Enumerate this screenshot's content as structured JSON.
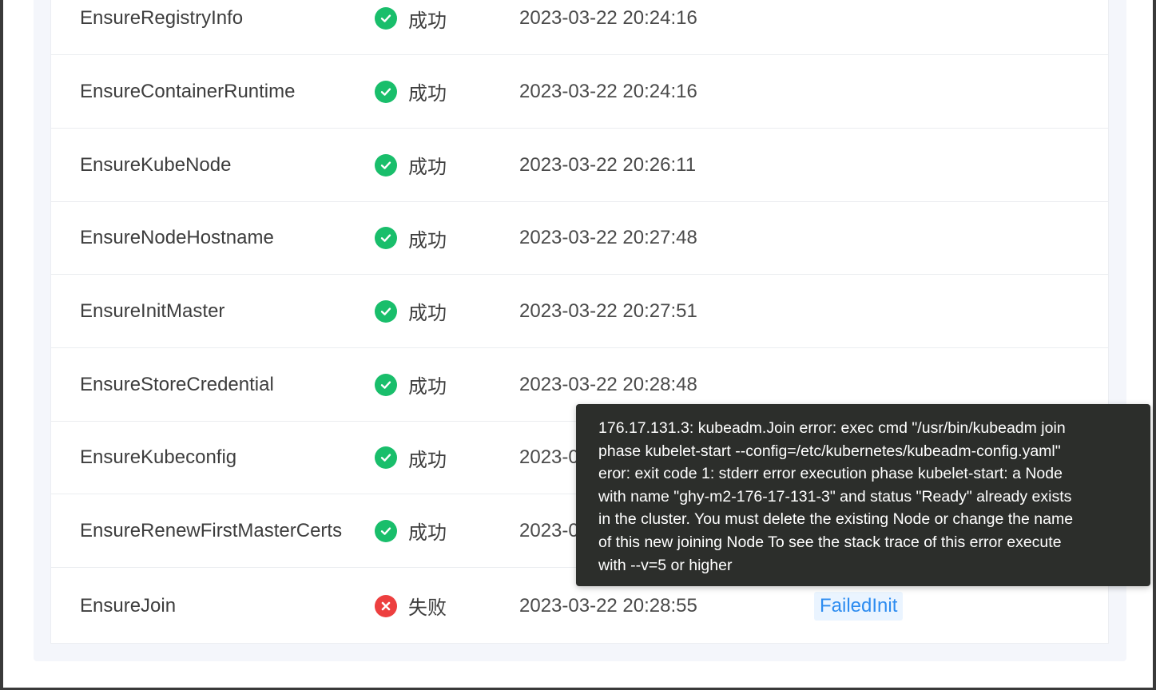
{
  "colors": {
    "success": "#19be6b",
    "failure": "#ed3f3f",
    "reason_text": "#2d8cf0",
    "reason_bg": "#eaf4ff",
    "tooltip_bg": "#2c2e2b"
  },
  "rows": [
    {
      "name": "EnsureRegistryInfo",
      "status": "成功",
      "status_icon": "success-check-icon",
      "time": "2023-03-22 20:24:16",
      "reason": ""
    },
    {
      "name": "EnsureContainerRuntime",
      "status": "成功",
      "status_icon": "success-check-icon",
      "time": "2023-03-22 20:24:16",
      "reason": ""
    },
    {
      "name": "EnsureKubeNode",
      "status": "成功",
      "status_icon": "success-check-icon",
      "time": "2023-03-22 20:26:11",
      "reason": ""
    },
    {
      "name": "EnsureNodeHostname",
      "status": "成功",
      "status_icon": "success-check-icon",
      "time": "2023-03-22 20:27:48",
      "reason": ""
    },
    {
      "name": "EnsureInitMaster",
      "status": "成功",
      "status_icon": "success-check-icon",
      "time": "2023-03-22 20:27:51",
      "reason": ""
    },
    {
      "name": "EnsureStoreCredential",
      "status": "成功",
      "status_icon": "success-check-icon",
      "time": "2023-03-22 20:28:48",
      "reason": ""
    },
    {
      "name": "EnsureKubeconfig",
      "status": "成功",
      "status_icon": "success-check-icon",
      "time": "2023-03-22 20:28:48",
      "reason": ""
    },
    {
      "name": "EnsureRenewFirstMasterCerts",
      "status": "成功",
      "status_icon": "success-check-icon",
      "time": "2023-03-22 20:28:50",
      "reason": ""
    },
    {
      "name": "EnsureJoin",
      "status": "失败",
      "status_icon": "failure-x-icon",
      "time": "2023-03-22 20:28:55",
      "reason": "FailedInit"
    }
  ],
  "tooltip": {
    "lines": [
      "176.17.131.3: kubeadm.Join error: exec cmd \"/usr/bin/kubeadm join",
      "phase kubelet-start --config=/etc/kubernetes/kubeadm-config.yaml\"",
      "eror: exit code 1: stderr error execution phase kubelet-start: a Node",
      "with name \"ghy-m2-176-17-131-3\" and status \"Ready\" already exists",
      "in the cluster. You must delete the existing Node or change the name",
      "of this new joining Node To see the stack trace of this error execute",
      "with --v=5 or higher"
    ]
  }
}
